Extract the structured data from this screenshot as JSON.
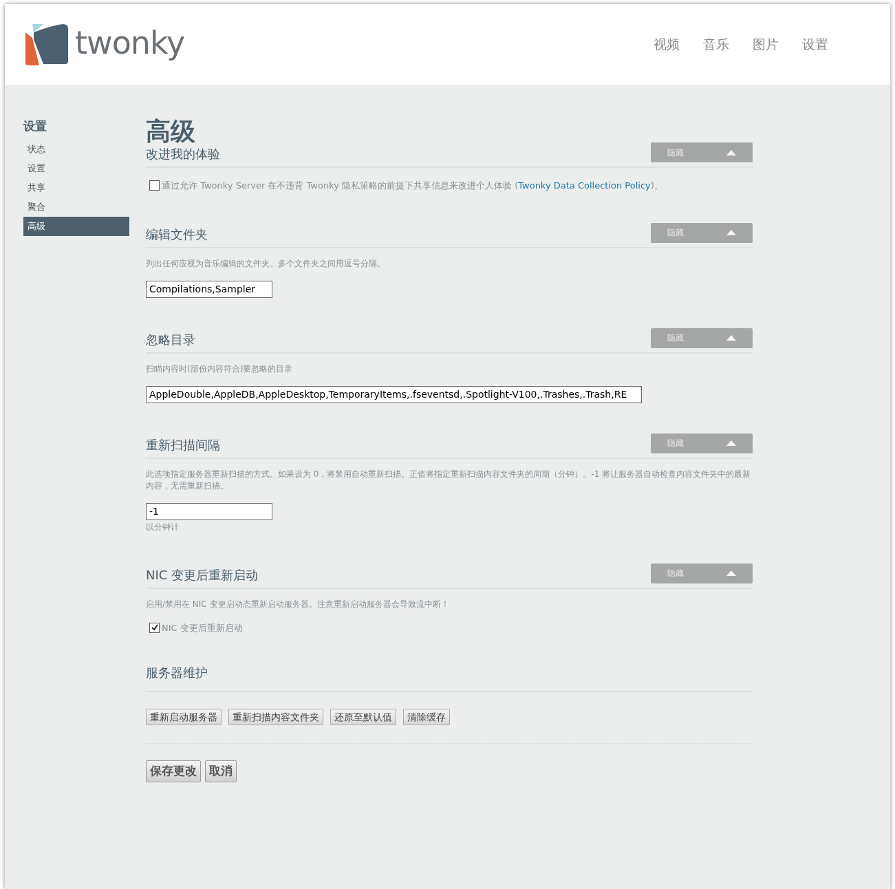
{
  "header": {
    "logo_text": "twonky",
    "nav": [
      {
        "label": "视频",
        "selected": false
      },
      {
        "label": "音乐",
        "selected": false
      },
      {
        "label": "图片",
        "selected": false
      },
      {
        "label": "设置",
        "selected": false
      }
    ]
  },
  "sidebar": {
    "title": "设置",
    "items": [
      {
        "label": "状态",
        "selected": false
      },
      {
        "label": "设置",
        "selected": false
      },
      {
        "label": "共享",
        "selected": false
      },
      {
        "label": "聚合",
        "selected": false
      },
      {
        "label": "高级",
        "selected": true
      }
    ]
  },
  "page_title": "高级",
  "sections": [
    {
      "title": "改进我的体验",
      "hide_button": "隐藏",
      "kind": "checkbox",
      "checked": false,
      "label": "通过允许 Twonky Server 在不违背 Twonky 隐私策略的前提下共享信息来改进个人体验 (",
      "link": "Twonky Data Collection Policy",
      "label_after": ")。"
    },
    {
      "title": "编辑文件夹",
      "hide_button": "隐藏",
      "description": "列出任何应视为音乐编辑的文件夹。多个文件夹之间用逗号分隔。",
      "kind": "field",
      "value": "Compilations,Sampler",
      "wide": false
    },
    {
      "title": "忽略目录",
      "hide_button": "隐藏",
      "description": "扫瞄内容时(部份内容符合)要忽略的目录",
      "kind": "field",
      "value": "AppleDouble,AppleDB,AppleDesktop,TemporaryItems,.fseventsd,.Spotlight-V100,.Trashes,.Trash,RE",
      "wide": true
    },
    {
      "title": "重新扫描间隔",
      "hide_button": "隐藏",
      "description": "此选项指定服务器重新扫描的方式。如果设为 0，将禁用自动重新扫描。正值将指定重新扫描内容文件夹的周期（分钟）。-1 将让服务器自动检查内容文件夹中的最新内容，无需重新扫描。",
      "kind": "field",
      "value": "-1",
      "wide": false,
      "unit": "以分钟计"
    },
    {
      "title": "NIC 变更后重新启动",
      "hide_button": "隐藏",
      "description": "启用/禁用在 NIC 变更启动态重新启动服务器。注意重新启动服务器会导致流中断！",
      "kind": "checkbox",
      "checked": true,
      "label": "NIC 变更后重新启动"
    },
    {
      "title": "服务器维护",
      "kind": "buttons",
      "buttons": [
        "重新启动服务器",
        "重新扫描内容文件夹",
        "还原至默认值",
        "清除缓存"
      ]
    }
  ],
  "footer_buttons": [
    "保存更改",
    "取消"
  ]
}
